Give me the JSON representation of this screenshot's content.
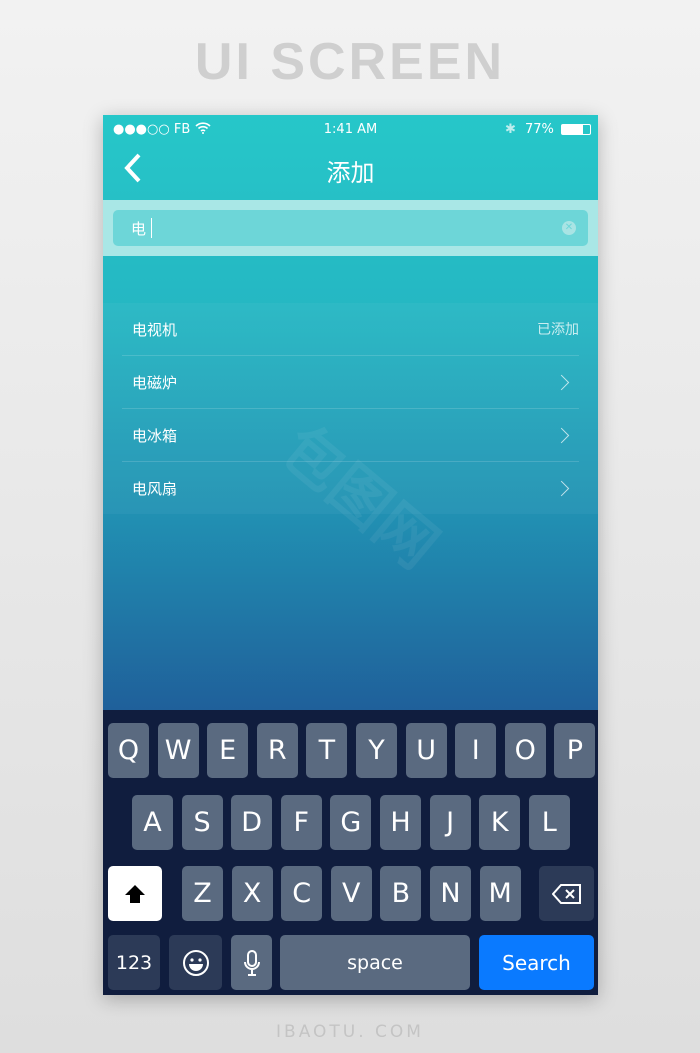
{
  "banner": "UI SCREEN",
  "footer": "IBAOTU. COM",
  "status": {
    "signal": "●●●○○ FB",
    "time": "1:41 AM",
    "battery": "77%"
  },
  "nav": {
    "title": "添加"
  },
  "search": {
    "value": "电"
  },
  "list": [
    {
      "label": "电视机",
      "status": "已添加"
    },
    {
      "label": "电磁炉"
    },
    {
      "label": "电冰箱"
    },
    {
      "label": "电风扇"
    }
  ],
  "keyboard": {
    "row1": [
      "Q",
      "W",
      "E",
      "R",
      "T",
      "Y",
      "U",
      "I",
      "O",
      "P"
    ],
    "row2": [
      "A",
      "S",
      "D",
      "F",
      "G",
      "H",
      "J",
      "K",
      "L"
    ],
    "row3": [
      "Z",
      "X",
      "C",
      "V",
      "B",
      "N",
      "M"
    ],
    "numbers": "123",
    "space": "space",
    "search": "Search"
  },
  "colors": {
    "accent": "#0a7aff",
    "teal": "#26c7c9"
  }
}
